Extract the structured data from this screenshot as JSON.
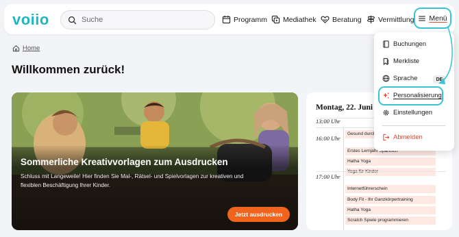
{
  "brand": {
    "logo": "voiio",
    "color": "#1fb6c4"
  },
  "search": {
    "placeholder": "Suche"
  },
  "nav": {
    "programm": "Programm",
    "mediathek": "Mediathek",
    "beratung": "Beratung",
    "vermittlung": "Vermittlung",
    "menu": "Menü"
  },
  "breadcrumb": {
    "home": "Home"
  },
  "page": {
    "title": "Willkommen zurück!"
  },
  "hero": {
    "title": "Sommerliche Kreativvorlagen zum Ausdrucken",
    "text": "Schluss mit Langeweile! Hier finden Sie Mal-, Rätsel- und Spielvorlagen zur kreativen und flexiblen Beschäftigung Ihrer Kinder.",
    "button": "Jetzt ausdrucken",
    "accent": "#f0641e"
  },
  "schedule": {
    "date": "Montag, 22. Juni",
    "times": [
      "13:00 Uhr",
      "16:00 Uhr",
      "17:00 Uhr"
    ],
    "events_16": [
      "Gesund durch den Tag",
      "Erstes Lernjahr Spanisch",
      "Hatha Yoga",
      "Yoga für Kinder"
    ],
    "events_17": [
      "Internetführerschein",
      "Body Fit - Ihr Ganzkörpertraining",
      "Hatha Yoga",
      "Scratch Spiele programmieren"
    ]
  },
  "menu": {
    "items": {
      "buchungen": "Buchungen",
      "merkliste": "Merkliste",
      "sprache": "Sprache",
      "sprache_badge": "DE",
      "personalisierung": "Personalisierung",
      "einstellungen": "Einstellungen",
      "abmelden": "Abmelden"
    },
    "highlight_color": "#36c6d2",
    "logout_color": "#e04b33"
  }
}
